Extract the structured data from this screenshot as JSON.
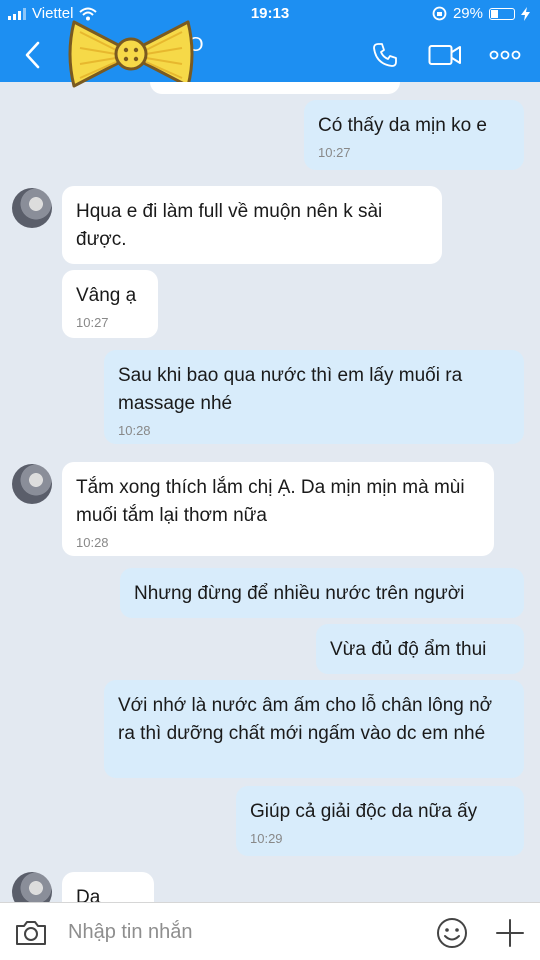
{
  "status_bar": {
    "carrier": "Viettel",
    "time": "19:13",
    "battery": "29%"
  },
  "header": {
    "contact_name": "O",
    "contact_status": ""
  },
  "messages": [
    {
      "text": "Có thấy da mịn ko e",
      "time": "10:27"
    },
    {
      "text": "Hqua e đi làm full về muộn nên k sài được.",
      "time": ""
    },
    {
      "text": "Vâng ạ",
      "time": "10:27"
    },
    {
      "text": "Sau khi bao qua nước thì em lấy muối ra massage nhé",
      "time": "10:28"
    },
    {
      "text": "Tắm xong thích lắm chị Ạ. Da mịn mịn mà mùi muối tắm lại thơm nữa",
      "time": "10:28"
    },
    {
      "text": "Nhưng đừng để nhiều nước trên người",
      "time": ""
    },
    {
      "text": "Vừa đủ độ ẩm thui",
      "time": ""
    },
    {
      "text": "Với nhớ là nước âm ấm cho lỗ chân lông nở ra thì dưỡng chất mới ngấm vào dc em nhé",
      "time": ""
    },
    {
      "text": "Giúp cả giải độc da nữa ấy",
      "time": "10:29"
    },
    {
      "text": "Dạ",
      "time": ""
    }
  ],
  "input": {
    "placeholder": "Nhập tin nhắn"
  },
  "colors": {
    "header": "#1d8ff2",
    "background": "#e3e9f1",
    "my_bubble": "#d8ecfb",
    "their_bubble": "#ffffff"
  }
}
